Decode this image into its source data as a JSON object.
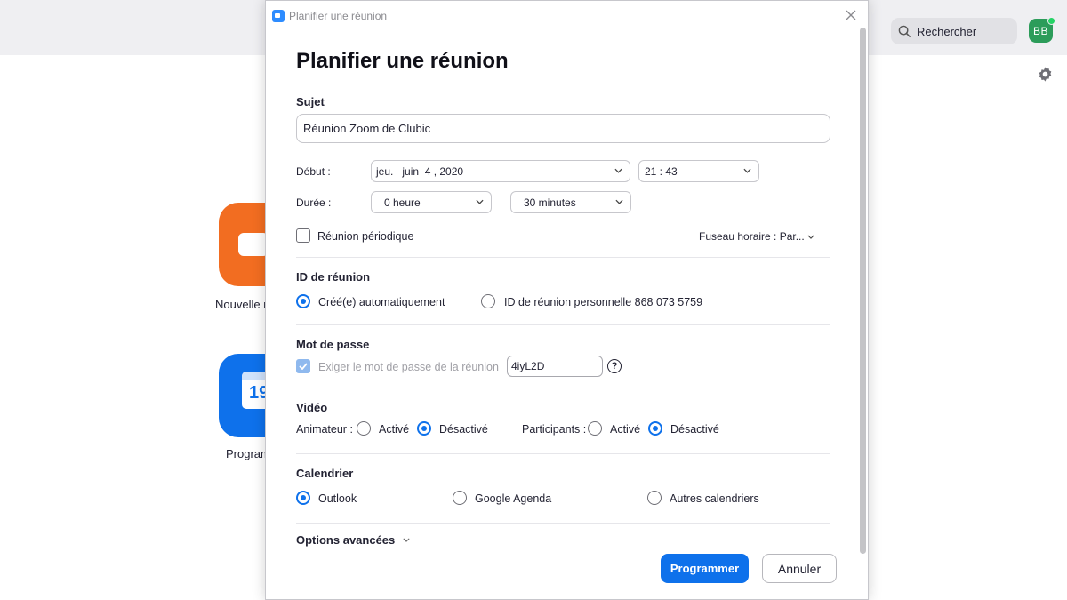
{
  "background": {
    "search_label": "Rechercher",
    "avatar_initials": "BB",
    "tiles": [
      {
        "label": "Nouvelle r",
        "icon": "camera-icon",
        "color": "#f26d21"
      },
      {
        "label": "Program",
        "icon": "calendar-icon",
        "color": "#0e71eb",
        "calendar_day": "19"
      }
    ]
  },
  "dialog": {
    "window_title": "Planifier une réunion",
    "heading": "Planifier une réunion",
    "subject": {
      "label": "Sujet",
      "value": "Réunion Zoom de Clubic"
    },
    "start": {
      "label": "Début :",
      "date": "jeu.   juin  4 , 2020",
      "time": "21 : 43"
    },
    "duration": {
      "label": "Durée :",
      "hours": "0 heure",
      "minutes": "30 minutes"
    },
    "recurring": {
      "label": "Réunion périodique",
      "checked": false
    },
    "timezone": {
      "label": "Fuseau horaire : Par..."
    },
    "meeting_id": {
      "label": "ID de réunion",
      "options": [
        {
          "label": "Créé(e) automatiquement",
          "selected": true
        },
        {
          "label": "ID de réunion personnelle 868 073 5759",
          "selected": false
        }
      ]
    },
    "password": {
      "label": "Mot de passe",
      "require_label": "Exiger le mot de passe de la réunion",
      "checked": true,
      "value": "4iyL2D",
      "help": "?"
    },
    "video": {
      "label": "Vidéo",
      "host": {
        "label": "Animateur :",
        "on": "Activé",
        "off": "Désactivé",
        "selected": "off"
      },
      "participants": {
        "label": "Participants :",
        "on": "Activé",
        "off": "Désactivé",
        "selected": "off"
      }
    },
    "calendar": {
      "label": "Calendrier",
      "options": [
        {
          "label": "Outlook",
          "selected": true
        },
        {
          "label": "Google Agenda",
          "selected": false
        },
        {
          "label": "Autres calendriers",
          "selected": false
        }
      ]
    },
    "advanced": {
      "label": "Options avancées"
    },
    "buttons": {
      "schedule": "Programmer",
      "cancel": "Annuler"
    },
    "accent_color": "#0e71eb"
  }
}
